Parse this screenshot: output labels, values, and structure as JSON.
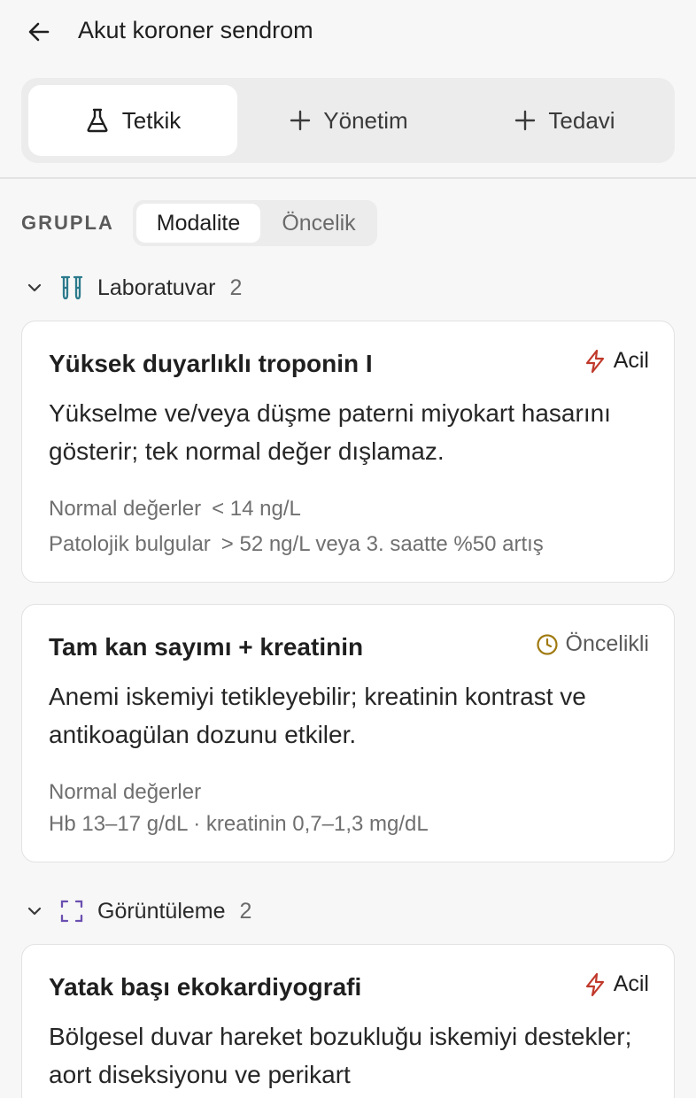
{
  "header": {
    "title": "Akut koroner sendrom",
    "back_icon": "arrow-left-icon"
  },
  "tabs": [
    {
      "label": "Tetkik",
      "icon": "flask-icon",
      "active": true
    },
    {
      "label": "Yönetim",
      "icon": "plus-icon",
      "active": false
    },
    {
      "label": "Tedavi",
      "icon": "plus-icon",
      "active": false
    }
  ],
  "grouping": {
    "label": "GRUPLA",
    "options": [
      {
        "label": "Modalite",
        "active": true
      },
      {
        "label": "Öncelik",
        "active": false
      }
    ]
  },
  "sections": [
    {
      "name": "Laboratuvar",
      "count": "2",
      "icon": "test-tubes-icon",
      "icon_color": "#2b7a8c"
    },
    {
      "name": "Görüntüleme",
      "count": "2",
      "icon": "scan-frame-icon",
      "icon_color": "#6b4fb0"
    }
  ],
  "cards": [
    {
      "title": "Yüksek duyarlıklı troponin I",
      "badge": {
        "label": "Acil",
        "icon": "lightning-icon",
        "color": "#c0392b"
      },
      "description": "Yükselme ve/veya düşme paterni miyokart hasarını gösterir; tek normal değer dışlamaz.",
      "normal_label": "Normal değerler",
      "normal_value": "< 14 ng/L",
      "patho_label": "Patolojik bulgular",
      "patho_value": "> 52 ng/L veya 3. saatte %50 artış"
    },
    {
      "title": "Tam kan sayımı + kreatinin",
      "badge": {
        "label": "Öncelikli",
        "icon": "clock-icon",
        "color": "#a07a10"
      },
      "description": "Anemi iskemiyi tetikleyebilir; kreatinin kontrast ve antikoagülan dozunu etkiler.",
      "normal_label": "Normal değerler",
      "normal_value": "Hb 13–17 g/dL · kreatinin 0,7–1,3 mg/dL"
    },
    {
      "title": "Yatak başı ekokardiyografi",
      "badge": {
        "label": "Acil",
        "icon": "lightning-icon",
        "color": "#c0392b"
      },
      "description": "Bölgesel duvar hareket bozukluğu iskemiyi destekler; aort diseksiyonu ve perikart"
    }
  ]
}
